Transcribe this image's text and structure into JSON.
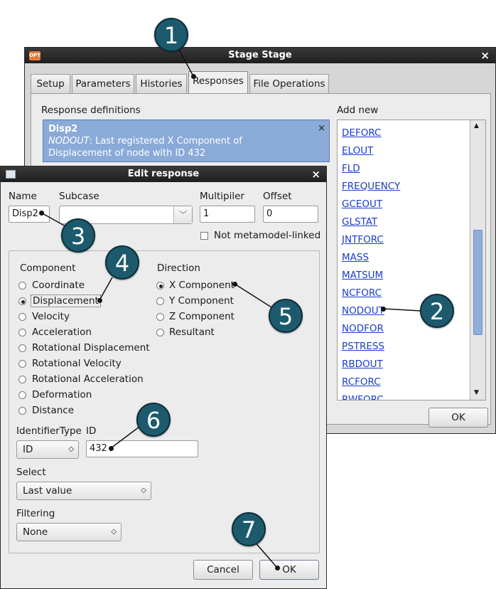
{
  "back_window": {
    "title": "Stage Stage",
    "tabs": [
      "Setup",
      "Parameters",
      "Histories",
      "Responses",
      "File Operations"
    ],
    "response_definitions_label": "Response definitions",
    "add_new_label": "Add new",
    "response": {
      "name": "Disp2",
      "source": "NODOUT",
      "description_line1": ": Last registered X Component of",
      "description_line2": "Displacement of node with ID 432"
    },
    "add_new_items": [
      "DEFORC",
      "ELOUT",
      "FLD",
      "FREQUENCY",
      "GCEOUT",
      "GLSTAT",
      "JNTFORC",
      "MASS",
      "MATSUM",
      "NCFORC",
      "NODOUT",
      "NODFOR",
      "PSTRESS",
      "RBDOUT",
      "RCFORC",
      "RWFORC"
    ],
    "ok_label": "OK",
    "close_glyph": "×"
  },
  "dialog": {
    "title": "Edit response",
    "close_glyph": "×",
    "name_label": "Name",
    "name_value": "Disp2",
    "subcase_label": "Subcase",
    "subcase_value": "",
    "multiplier_label": "Multipiler",
    "multiplier_value": "1",
    "offset_label": "Offset",
    "offset_value": "0",
    "metamodel_label": "Not metamodel-linked",
    "component_label": "Component",
    "components": [
      "Coordinate",
      "Displacement",
      "Velocity",
      "Acceleration",
      "Rotational Displacement",
      "Rotational Velocity",
      "Rotational Acceleration",
      "Deformation",
      "Distance"
    ],
    "direction_label": "Direction",
    "directions": [
      "X Component",
      "Y Component",
      "Z Component",
      "Resultant"
    ],
    "identifier_type_label": "IdentifierType",
    "identifier_type_value": "ID",
    "id_label": "ID",
    "id_value": "432",
    "select_label": "Select",
    "select_value": "Last value",
    "filtering_label": "Filtering",
    "filtering_value": "None",
    "cancel_label": "Cancel",
    "ok_label": "OK"
  },
  "callouts": [
    "1",
    "2",
    "3",
    "4",
    "5",
    "6",
    "7"
  ],
  "colors": {
    "callout": "#1d5a6e",
    "selection": "#8aaad8",
    "link": "#1a3ccc"
  }
}
